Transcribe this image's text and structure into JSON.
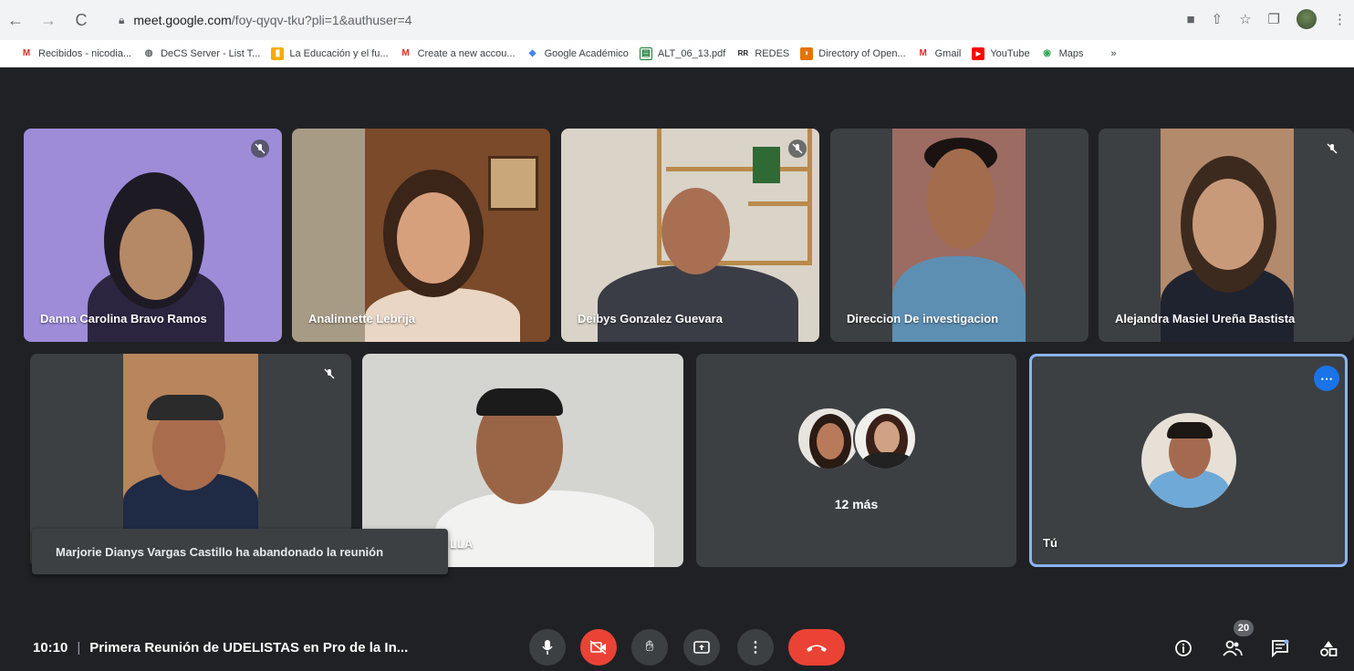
{
  "browser": {
    "url_host": "meet.google.com",
    "url_path": "/foy-qyqv-tku?pli=1&authuser=4"
  },
  "bookmarks": [
    {
      "label": "Recibidos - nicodia...",
      "icon": "gmail-icon",
      "color": "#d93025"
    },
    {
      "label": "DeCS Server - List T...",
      "icon": "globe-icon",
      "color": "#5f6368"
    },
    {
      "label": "La Educación y el fu...",
      "icon": "bookmark-icon",
      "color": "#f9ab00"
    },
    {
      "label": "Create a new accou...",
      "icon": "gmail-icon",
      "color": "#d93025"
    },
    {
      "label": "Google Académico",
      "icon": "scholar-icon",
      "color": "#4285f4"
    },
    {
      "label": "ALT_06_13.pdf",
      "icon": "pdf-icon",
      "color": "#188038"
    },
    {
      "label": "REDES",
      "icon": "redes-icon",
      "color": "#202124"
    },
    {
      "label": "Directory of Open...",
      "icon": "doaj-icon",
      "color": "#e37400"
    },
    {
      "label": "Gmail",
      "icon": "gmail-icon",
      "color": "#d93025"
    },
    {
      "label": "YouTube",
      "icon": "youtube-icon",
      "color": "#ff0000"
    },
    {
      "label": "Maps",
      "icon": "maps-icon",
      "color": "#34a853"
    }
  ],
  "participants": {
    "p1": "Danna Carolina Bravo Ramos",
    "p2": "Analinnette Lebrija",
    "p3": "Deibys Gonzalez Guevara",
    "p4": "Direccion De investigacion",
    "p5": "Alejandra Masiel Ureña Bastista",
    "p7_partial": "LLA",
    "more": "12 más",
    "self": "Tú"
  },
  "toast": "Marjorie Dianys Vargas Castillo ha abandonado la reunión",
  "bottom": {
    "time": "10:10",
    "separator": "|",
    "title": "Primera Reunión de UDELISTAS en Pro de la In...",
    "people_count": "20"
  },
  "colors": {
    "background": "#202124",
    "tile": "#3c4043",
    "end_call": "#ea4335",
    "active_border": "#8ab4f8",
    "more_button": "#1a73e8"
  }
}
